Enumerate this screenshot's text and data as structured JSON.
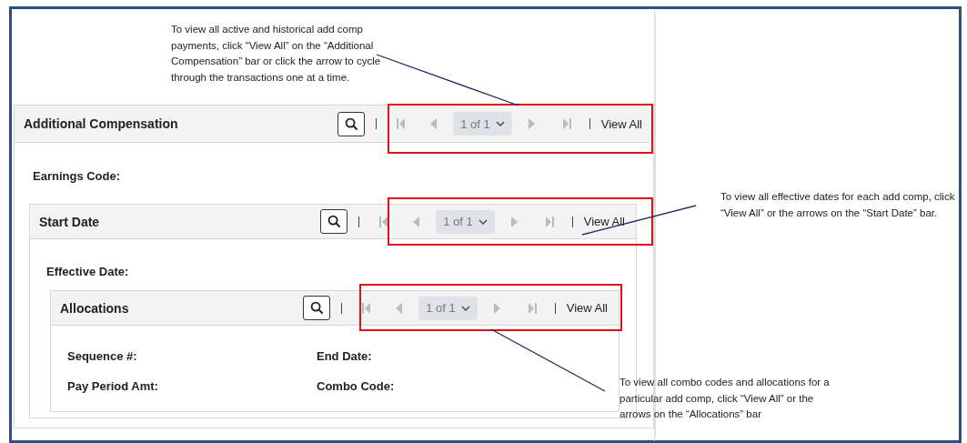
{
  "panel": {
    "title": "Additional Compensation",
    "pager": {
      "page": "1 of 1",
      "view_all": "View All",
      "arrows_disabled": true
    },
    "fields": [
      {
        "label": "Earnings Code:"
      }
    ],
    "child": {
      "title": "Start Date",
      "pager": {
        "page": "1 of 1",
        "view_all": "View All",
        "arrows_disabled": true
      },
      "fields": [
        {
          "label": "Effective Date:"
        }
      ],
      "child": {
        "title": "Allocations",
        "pager": {
          "page": "1 of 1",
          "view_all": "View All",
          "arrows_disabled": true
        },
        "grid": true,
        "fields": [
          {
            "label": "Sequence #:"
          },
          {
            "label": "End Date:"
          },
          {
            "label": "Pay Period Amt:"
          },
          {
            "label": "Combo Code:"
          }
        ]
      }
    }
  },
  "annotations": [
    {
      "text": "To view all active and historical add comp payments, click “View All” on the “Additional Compensation” bar or click the arrow to cycle through the transactions one at a time."
    },
    {
      "text": "To view all effective dates for each add comp, click “View All” or the arrows on the “Start Date” bar."
    },
    {
      "text": "To view all combo codes and allocations for a particular add comp, click “View All” or the arrows on the “Allocations” bar"
    }
  ]
}
